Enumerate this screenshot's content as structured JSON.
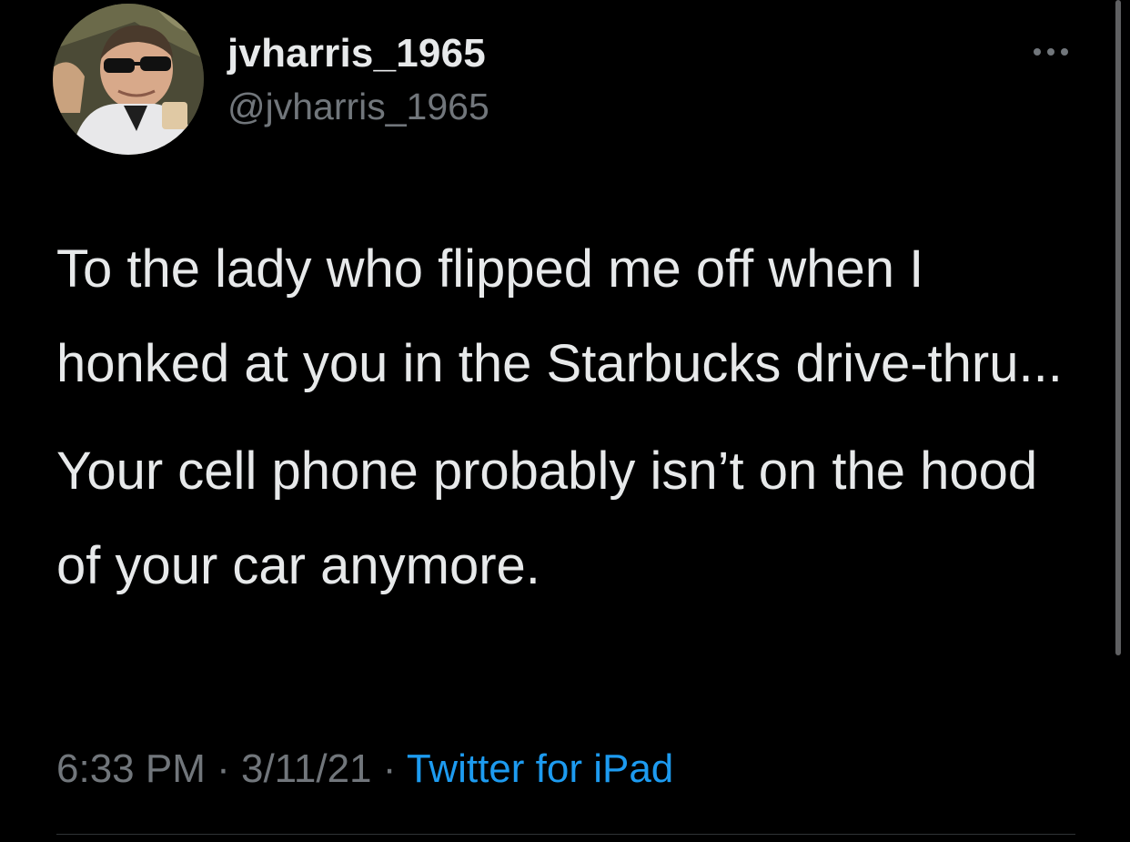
{
  "user": {
    "display_name": "jvharris_1965",
    "handle": "@jvharris_1965",
    "avatar_icon": "profile-photo"
  },
  "menu": {
    "more_icon": "ellipsis-icon"
  },
  "tweet": {
    "paragraphs": [
      "To the lady who flipped me off when I honked at you in the Starbucks drive-thru...",
      "Your cell phone probably isn’t on the hood of your car anymore."
    ]
  },
  "meta": {
    "time": "6:33 PM",
    "separator": " · ",
    "date": "3/11/21",
    "source": "Twitter for iPad"
  },
  "colors": {
    "background": "#000000",
    "text_primary": "#e7e9ea",
    "text_secondary": "#71767b",
    "link": "#1d9bf0",
    "divider": "#2f3336"
  }
}
